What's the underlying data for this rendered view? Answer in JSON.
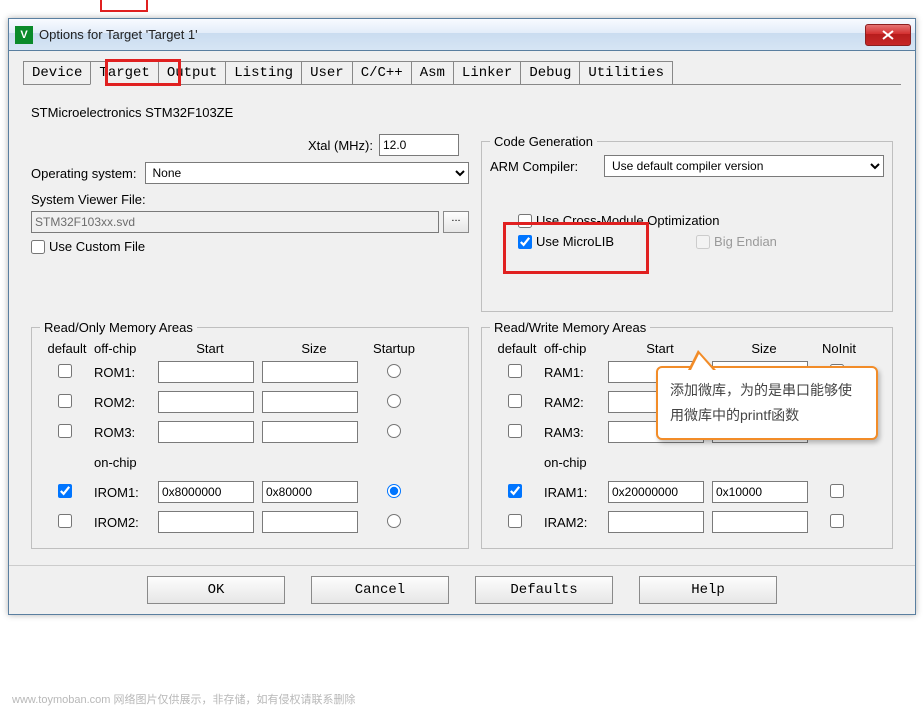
{
  "window": {
    "title": "Options for Target 'Target 1'"
  },
  "tabs": [
    "Device",
    "Target",
    "Output",
    "Listing",
    "User",
    "C/C++",
    "Asm",
    "Linker",
    "Debug",
    "Utilities"
  ],
  "active_tab": "Target",
  "mcu": "STMicroelectronics STM32F103ZE",
  "xtal": {
    "label": "Xtal (MHz):",
    "value": "12.0"
  },
  "os": {
    "label": "Operating system:",
    "value": "None"
  },
  "svd": {
    "label": "System Viewer File:",
    "value": "STM32F103xx.svd"
  },
  "use_custom": {
    "label": "Use Custom File",
    "checked": false
  },
  "codegen": {
    "legend": "Code Generation",
    "arm_label": "ARM Compiler:",
    "arm_value": "Use default compiler version",
    "crossmod": {
      "label": "Use Cross-Module Optimization",
      "checked": false
    },
    "microlib": {
      "label": "Use MicroLIB",
      "checked": true
    },
    "bigendian": {
      "label": "Big Endian",
      "checked": false
    }
  },
  "ro": {
    "legend": "Read/Only Memory Areas",
    "cols": {
      "default": "default",
      "offchip": "off-chip",
      "start": "Start",
      "size": "Size",
      "startup": "Startup"
    },
    "onchip": "on-chip",
    "rows": [
      {
        "name": "ROM1:",
        "default": false,
        "start": "",
        "size": "",
        "startup": false
      },
      {
        "name": "ROM2:",
        "default": false,
        "start": "",
        "size": "",
        "startup": false
      },
      {
        "name": "ROM3:",
        "default": false,
        "start": "",
        "size": "",
        "startup": false
      },
      {
        "name": "IROM1:",
        "default": true,
        "start": "0x8000000",
        "size": "0x80000",
        "startup": true
      },
      {
        "name": "IROM2:",
        "default": false,
        "start": "",
        "size": "",
        "startup": false
      }
    ]
  },
  "rw": {
    "legend": "Read/Write Memory Areas",
    "cols": {
      "default": "default",
      "offchip": "off-chip",
      "start": "Start",
      "size": "Size",
      "noinit": "NoInit"
    },
    "onchip": "on-chip",
    "rows": [
      {
        "name": "RAM1:",
        "default": false,
        "start": "",
        "size": "",
        "noinit": false
      },
      {
        "name": "RAM2:",
        "default": false,
        "start": "",
        "size": "",
        "noinit": false
      },
      {
        "name": "RAM3:",
        "default": false,
        "start": "",
        "size": "",
        "noinit": false
      },
      {
        "name": "IRAM1:",
        "default": true,
        "start": "0x20000000",
        "size": "0x10000",
        "noinit": false
      },
      {
        "name": "IRAM2:",
        "default": false,
        "start": "",
        "size": "",
        "noinit": false
      }
    ]
  },
  "buttons": {
    "ok": "OK",
    "cancel": "Cancel",
    "defaults": "Defaults",
    "help": "Help"
  },
  "callout": "添加微库，为的是串口能够使用微库中的printf函数",
  "watermark": "www.toymoban.com  网络图片仅供展示，非存储，如有侵权请联系删除"
}
